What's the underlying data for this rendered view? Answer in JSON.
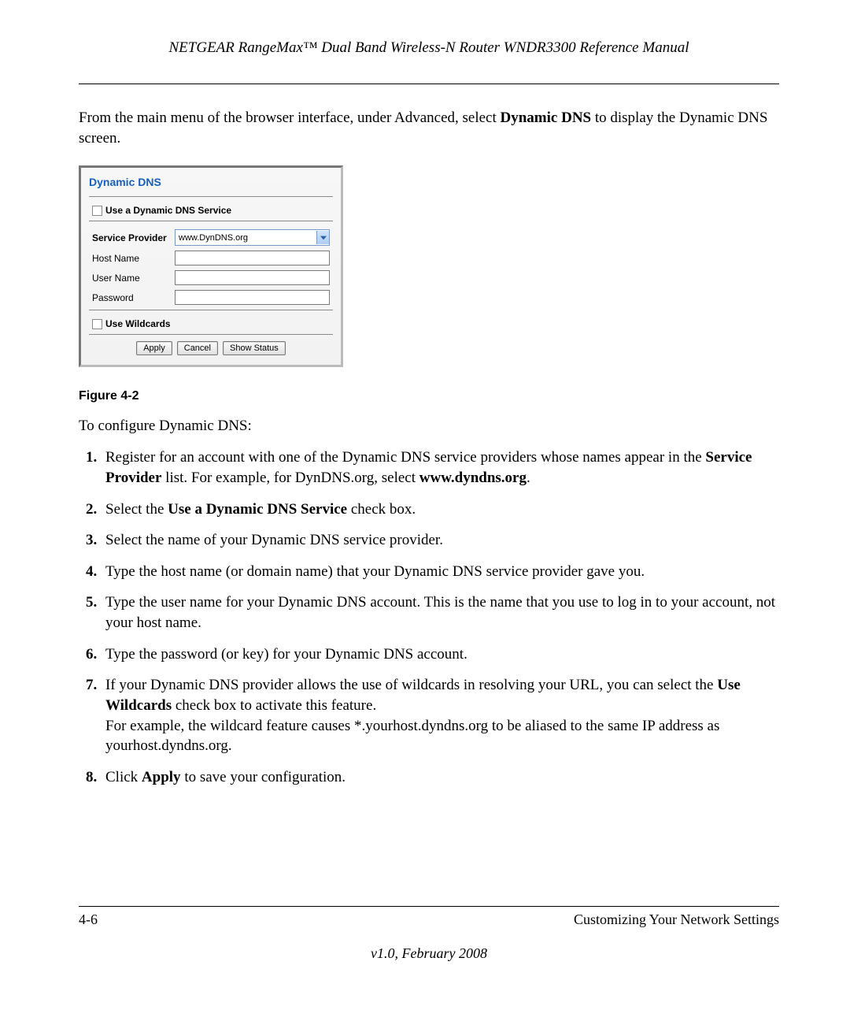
{
  "header": "NETGEAR RangeMax™ Dual Band Wireless-N Router WNDR3300 Reference Manual",
  "intro": {
    "pre": "From the main menu of the browser interface, under Advanced, select ",
    "bold": "Dynamic DNS",
    "post": " to display the Dynamic DNS screen."
  },
  "panel": {
    "title": "Dynamic DNS",
    "use_service_label": "Use a Dynamic DNS Service",
    "service_provider_label": "Service Provider",
    "service_provider_value": "www.DynDNS.org",
    "host_name_label": "Host Name",
    "user_name_label": "User Name",
    "password_label": "Password",
    "use_wildcards_label": "Use Wildcards",
    "buttons": {
      "apply": "Apply",
      "cancel": "Cancel",
      "show_status": "Show Status"
    }
  },
  "figure_caption": "Figure 4-2",
  "configure_heading": "To configure Dynamic DNS:",
  "steps": {
    "s1": {
      "pre": "Register for an account with one of the Dynamic DNS service providers whose names appear in the ",
      "b1": "Service Provider",
      "mid": " list. For example, for DynDNS.org, select ",
      "b2": "www.dyndns.org",
      "post": "."
    },
    "s2": {
      "pre": "Select the ",
      "b1": "Use a Dynamic DNS Service",
      "post": " check box."
    },
    "s3": "Select the name of your Dynamic DNS service provider.",
    "s4": "Type the host name (or domain name) that your Dynamic DNS service provider gave you.",
    "s5": "Type the user name for your Dynamic DNS account. This is the name that you use to log in to your account, not your host name.",
    "s6": "Type the password (or key) for your Dynamic DNS account.",
    "s7": {
      "pre": "If your Dynamic DNS provider allows the use of wildcards in resolving your URL, you can select the ",
      "b1": "Use Wildcards",
      "mid": " check box to activate this feature.",
      "br": "For example, the wildcard feature causes *.yourhost.dyndns.org to be aliased to the same IP address as yourhost.dyndns.org."
    },
    "s8": {
      "pre": "Click ",
      "b1": "Apply",
      "post": " to save your configuration."
    }
  },
  "footer": {
    "left": "4-6",
    "right": "Customizing Your Network Settings",
    "version": "v1.0, February 2008"
  }
}
